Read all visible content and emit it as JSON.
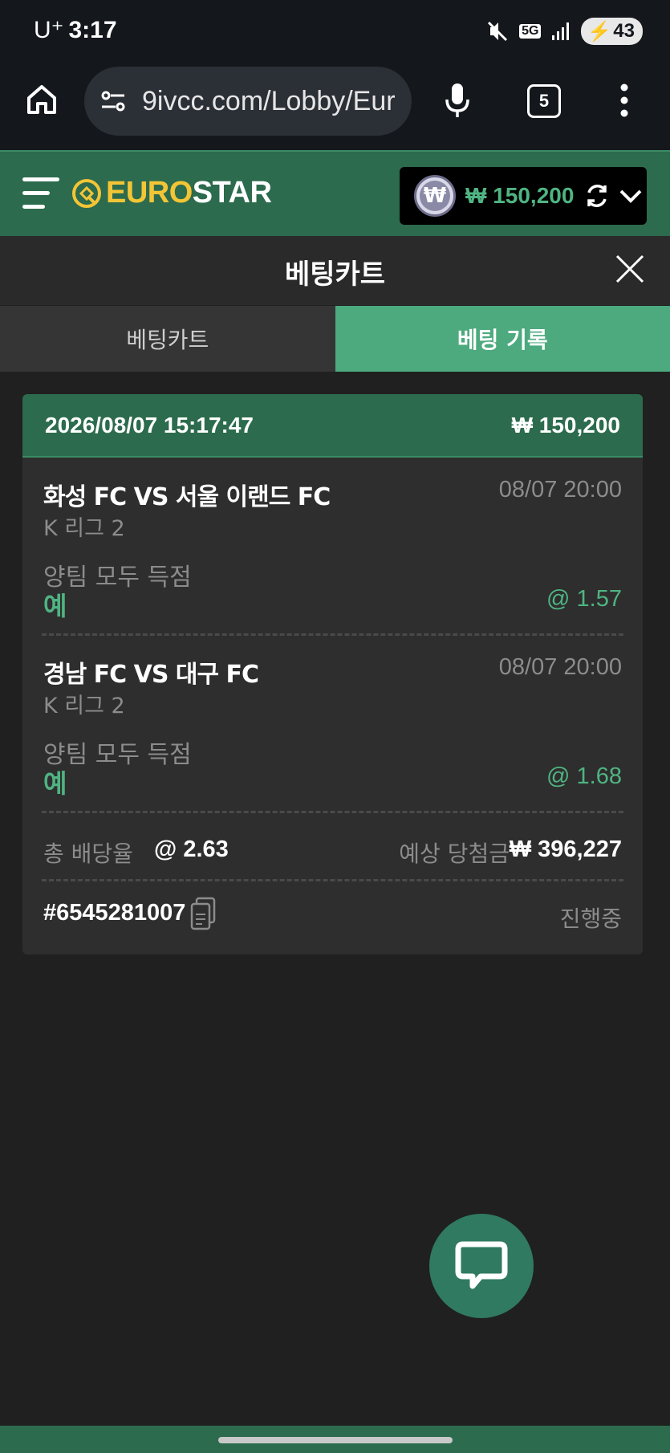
{
  "status_bar": {
    "carrier": "U⁺",
    "time": "3:17",
    "network": "5G",
    "battery": "43"
  },
  "browser": {
    "url": "9ivcc.com/Lobby/Eur",
    "tab_count": "5"
  },
  "header": {
    "logo_part1": "EURO",
    "logo_part2": "STAR",
    "balance": "₩ 150,200",
    "currency_symbol": "₩"
  },
  "cart": {
    "title": "베팅카트"
  },
  "tabs": [
    {
      "label": "베팅카트",
      "active": false
    },
    {
      "label": "베팅 기록",
      "active": true
    }
  ],
  "bet": {
    "datetime": "2026/08/07 15:17:47",
    "stake": "₩ 150,200",
    "selections": [
      {
        "match": "화성 FC VS 서울 이랜드 FC",
        "time": "08/07 20:00",
        "league": "K 리그 2",
        "market": "양팀 모두 득점",
        "pick": "예",
        "odds": "@ 1.57"
      },
      {
        "match": "경남 FC VS 대구 FC",
        "time": "08/07 20:00",
        "league": "K 리그 2",
        "market": "양팀 모두 득점",
        "pick": "예",
        "odds": "@ 1.68"
      }
    ],
    "total_odds_label": "총 배당율",
    "total_odds": "@ 2.63",
    "expected_win_label": "예상 당첨금",
    "expected_win": "₩ 396,227",
    "ticket_id": "#6545281007",
    "status": "진행중"
  },
  "colors": {
    "accent": "#2c6b4d",
    "accent_light": "#4caa7e",
    "odds_green": "#4fb482",
    "logo_yellow": "#f3c536"
  }
}
